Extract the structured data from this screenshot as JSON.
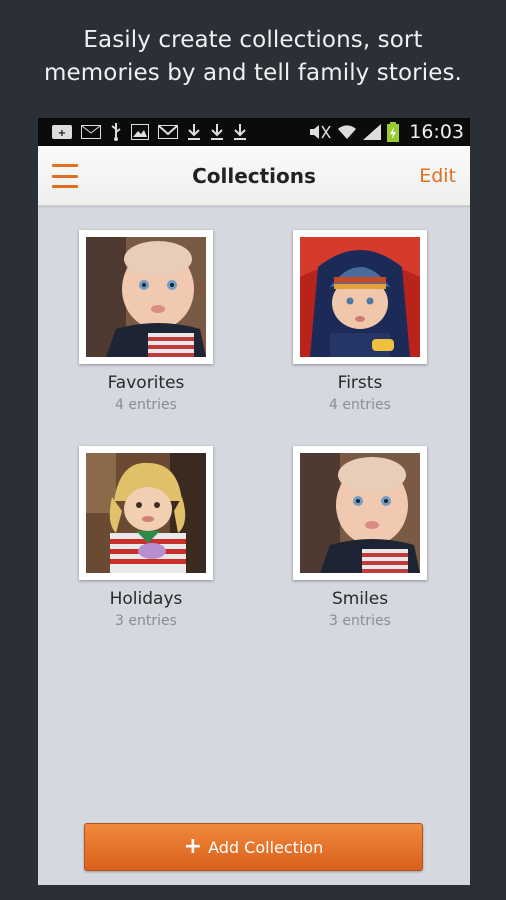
{
  "promo": {
    "line1": "Easily create collections, sort",
    "line2": "memories by and tell family stories."
  },
  "status_bar": {
    "time": "16:03",
    "icons": [
      "google-plus-icon",
      "mail-icon",
      "usb-icon",
      "image-icon",
      "gmail-icon",
      "download-icon",
      "download-icon",
      "download-icon",
      "mute-icon",
      "wifi-icon",
      "signal-icon",
      "battery-charging-icon"
    ]
  },
  "app_bar": {
    "title": "Collections",
    "edit_label": "Edit",
    "menu_icon": "hamburger-menu-icon"
  },
  "collections": [
    {
      "name": "Favorites",
      "count": "4 entries",
      "photo": "baby-portrait"
    },
    {
      "name": "Firsts",
      "count": "4 entries",
      "photo": "baby-in-stroller-hat"
    },
    {
      "name": "Holidays",
      "count": "3 entries",
      "photo": "toddler-winter-hat"
    },
    {
      "name": "Smiles",
      "count": "3 entries",
      "photo": "baby-portrait"
    }
  ],
  "add_button": {
    "label": "Add Collection"
  },
  "colors": {
    "accent": "#e0701e",
    "button": "#e66f28",
    "background": "#2b2f36",
    "content_bg": "#d6d8e0"
  }
}
